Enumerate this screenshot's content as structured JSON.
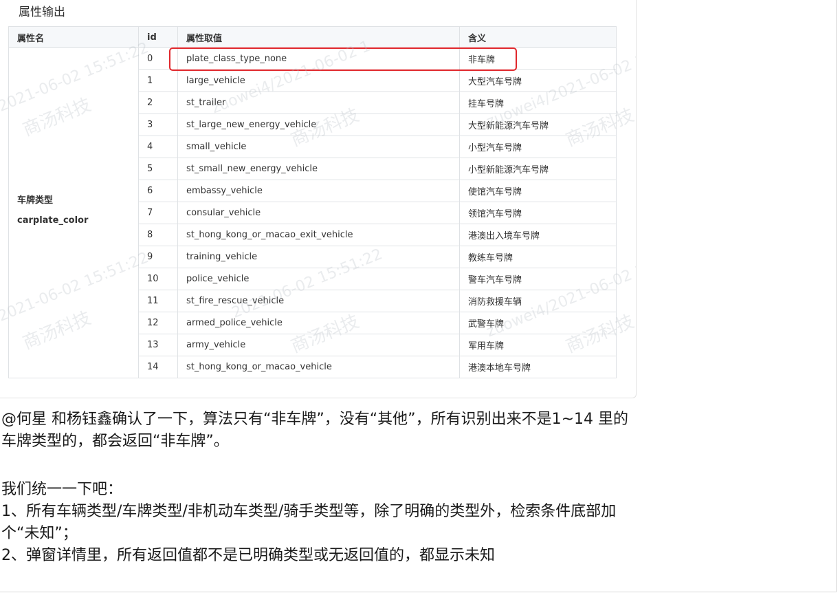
{
  "doc_heading": "属性输出",
  "table": {
    "headers": [
      "属性名",
      "id",
      "属性取值",
      "含义"
    ],
    "attribute_name_cn": "车牌类型",
    "attribute_name_en": "carplate_color",
    "rows": [
      {
        "id": "0",
        "value": "plate_class_type_none",
        "meaning": "非车牌",
        "highlighted": true
      },
      {
        "id": "1",
        "value": "large_vehicle",
        "meaning": "大型汽车号牌"
      },
      {
        "id": "2",
        "value": "st_trailer",
        "meaning": "挂车号牌"
      },
      {
        "id": "3",
        "value": "st_large_new_energy_vehicle",
        "meaning": "大型新能源汽车号牌"
      },
      {
        "id": "4",
        "value": "small_vehicle",
        "meaning": "小型汽车号牌"
      },
      {
        "id": "5",
        "value": "st_small_new_energy_vehicle",
        "meaning": "小型新能源汽车号牌"
      },
      {
        "id": "6",
        "value": "embassy_vehicle",
        "meaning": "使馆汽车号牌"
      },
      {
        "id": "7",
        "value": "consular_vehicle",
        "meaning": "领馆汽车号牌"
      },
      {
        "id": "8",
        "value": "st_hong_kong_or_macao_exit_vehicle",
        "meaning": "港澳出入境车号牌"
      },
      {
        "id": "9",
        "value": "training_vehicle",
        "meaning": "教练车号牌"
      },
      {
        "id": "10",
        "value": "police_vehicle",
        "meaning": "警车汽车号牌"
      },
      {
        "id": "11",
        "value": "st_fire_rescue_vehicle",
        "meaning": "消防救援车辆"
      },
      {
        "id": "12",
        "value": "armed_police_vehicle",
        "meaning": "武警车牌"
      },
      {
        "id": "13",
        "value": "army_vehicle",
        "meaning": "军用车牌"
      },
      {
        "id": "14",
        "value": "st_hong_kong_or_macao_vehicle",
        "meaning": "港澳本地车号牌"
      }
    ]
  },
  "watermarks": {
    "company": "商汤科技",
    "timestamp_a": "2021-06-02 15:51:22",
    "timestamp_b": "zuowei4/2021-06-02 1"
  },
  "message": {
    "line1": "@何星 和杨钰鑫确认了一下，算法只有“非车牌”，没有“其他”，所有识别出来不是1~14 里的",
    "line2": "车牌类型的，都会返回“非车牌”。",
    "line3": "我们统一一下吧：",
    "line4": "1、所有车辆类型/车牌类型/非机动车类型/骑手类型等，除了明确的类型外，检索条件底部加",
    "line5": "个“未知”；",
    "line6": "2、弹窗详情里，所有返回值都不是已明确类型或无返回值的，都显示未知"
  },
  "colors": {
    "highlight": "#e0262b",
    "header_bg": "#f6f8fa",
    "border": "#dfe2e5"
  }
}
